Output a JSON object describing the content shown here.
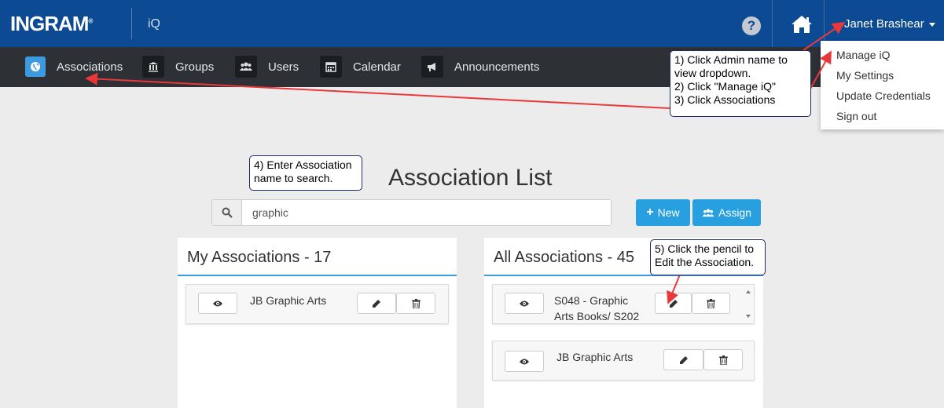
{
  "header": {
    "logo_text": "INGRAM",
    "logo_mark": "®",
    "app_name": "iQ",
    "help_label": "?",
    "user_name": "Janet Brashear"
  },
  "nav": {
    "items": [
      {
        "label": "Associations",
        "icon": "globe-icon",
        "active": true
      },
      {
        "label": "Groups",
        "icon": "bank-icon"
      },
      {
        "label": "Users",
        "icon": "users-icon"
      },
      {
        "label": "Calendar",
        "icon": "calendar-icon"
      },
      {
        "label": "Announcements",
        "icon": "megaphone-icon"
      }
    ]
  },
  "user_dropdown": {
    "items": [
      "Manage iQ",
      "My Settings",
      "Update Credentials",
      "Sign out"
    ]
  },
  "callouts": {
    "step1": "1) Click Admin name to\nview dropdown.\n2) Click \"Manage iQ\"\n3) Click Associations",
    "step4": "4) Enter Association\nname to search.",
    "step5": "5) Click the pencil to\nEdit the Association."
  },
  "main": {
    "title": "Association List",
    "search_value": "graphic",
    "new_label": "New",
    "assign_label": "Assign"
  },
  "my_associations": {
    "title": "My Associations - 17",
    "rows": [
      "JB Graphic Arts"
    ]
  },
  "all_associations": {
    "title": "All Associations - 45",
    "rows": [
      "S048 - Graphic Arts Books/ S202",
      "JB Graphic Arts"
    ]
  },
  "colors": {
    "header_blue": "#0c4a93",
    "nav_dark": "#2d3135",
    "accent_blue": "#28a0e0",
    "annotation_red": "#e8383a",
    "callout_border": "#1c2b6b"
  }
}
